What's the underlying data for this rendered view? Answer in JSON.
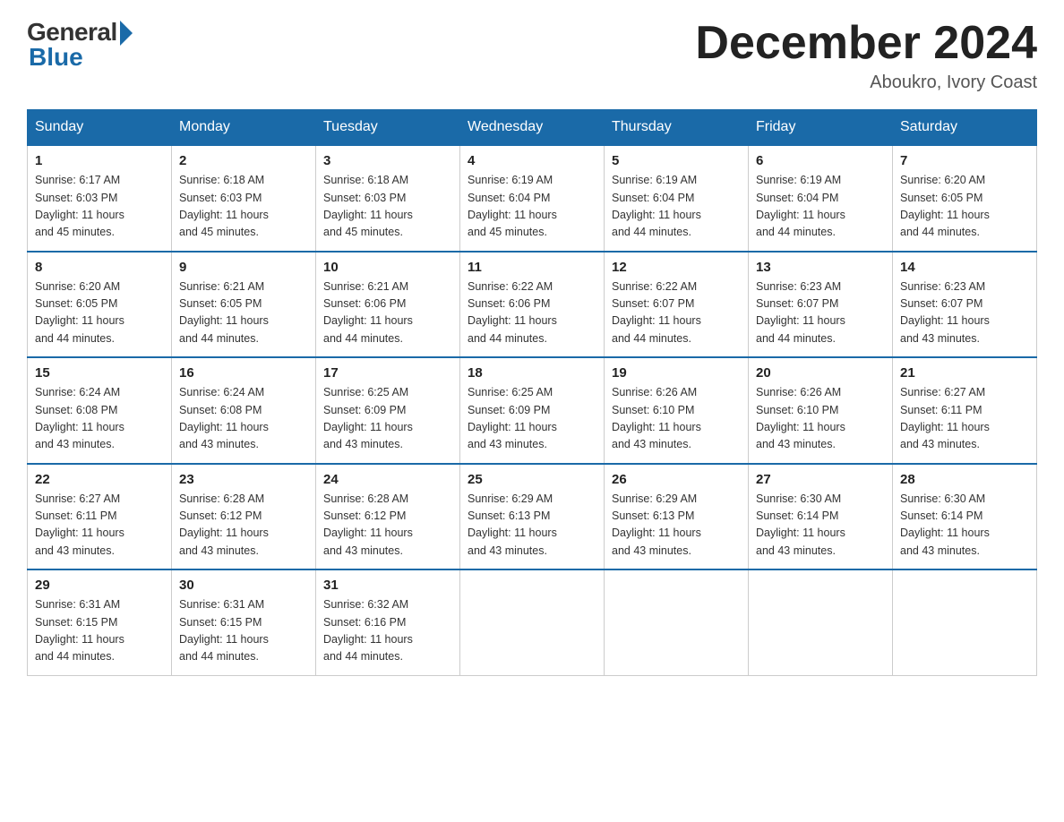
{
  "logo": {
    "general": "General",
    "blue": "Blue"
  },
  "title": "December 2024",
  "location": "Aboukro, Ivory Coast",
  "days_of_week": [
    "Sunday",
    "Monday",
    "Tuesday",
    "Wednesday",
    "Thursday",
    "Friday",
    "Saturday"
  ],
  "weeks": [
    [
      {
        "day": "1",
        "sunrise": "6:17 AM",
        "sunset": "6:03 PM",
        "daylight": "11 hours and 45 minutes."
      },
      {
        "day": "2",
        "sunrise": "6:18 AM",
        "sunset": "6:03 PM",
        "daylight": "11 hours and 45 minutes."
      },
      {
        "day": "3",
        "sunrise": "6:18 AM",
        "sunset": "6:03 PM",
        "daylight": "11 hours and 45 minutes."
      },
      {
        "day": "4",
        "sunrise": "6:19 AM",
        "sunset": "6:04 PM",
        "daylight": "11 hours and 45 minutes."
      },
      {
        "day": "5",
        "sunrise": "6:19 AM",
        "sunset": "6:04 PM",
        "daylight": "11 hours and 44 minutes."
      },
      {
        "day": "6",
        "sunrise": "6:19 AM",
        "sunset": "6:04 PM",
        "daylight": "11 hours and 44 minutes."
      },
      {
        "day": "7",
        "sunrise": "6:20 AM",
        "sunset": "6:05 PM",
        "daylight": "11 hours and 44 minutes."
      }
    ],
    [
      {
        "day": "8",
        "sunrise": "6:20 AM",
        "sunset": "6:05 PM",
        "daylight": "11 hours and 44 minutes."
      },
      {
        "day": "9",
        "sunrise": "6:21 AM",
        "sunset": "6:05 PM",
        "daylight": "11 hours and 44 minutes."
      },
      {
        "day": "10",
        "sunrise": "6:21 AM",
        "sunset": "6:06 PM",
        "daylight": "11 hours and 44 minutes."
      },
      {
        "day": "11",
        "sunrise": "6:22 AM",
        "sunset": "6:06 PM",
        "daylight": "11 hours and 44 minutes."
      },
      {
        "day": "12",
        "sunrise": "6:22 AM",
        "sunset": "6:07 PM",
        "daylight": "11 hours and 44 minutes."
      },
      {
        "day": "13",
        "sunrise": "6:23 AM",
        "sunset": "6:07 PM",
        "daylight": "11 hours and 44 minutes."
      },
      {
        "day": "14",
        "sunrise": "6:23 AM",
        "sunset": "6:07 PM",
        "daylight": "11 hours and 43 minutes."
      }
    ],
    [
      {
        "day": "15",
        "sunrise": "6:24 AM",
        "sunset": "6:08 PM",
        "daylight": "11 hours and 43 minutes."
      },
      {
        "day": "16",
        "sunrise": "6:24 AM",
        "sunset": "6:08 PM",
        "daylight": "11 hours and 43 minutes."
      },
      {
        "day": "17",
        "sunrise": "6:25 AM",
        "sunset": "6:09 PM",
        "daylight": "11 hours and 43 minutes."
      },
      {
        "day": "18",
        "sunrise": "6:25 AM",
        "sunset": "6:09 PM",
        "daylight": "11 hours and 43 minutes."
      },
      {
        "day": "19",
        "sunrise": "6:26 AM",
        "sunset": "6:10 PM",
        "daylight": "11 hours and 43 minutes."
      },
      {
        "day": "20",
        "sunrise": "6:26 AM",
        "sunset": "6:10 PM",
        "daylight": "11 hours and 43 minutes."
      },
      {
        "day": "21",
        "sunrise": "6:27 AM",
        "sunset": "6:11 PM",
        "daylight": "11 hours and 43 minutes."
      }
    ],
    [
      {
        "day": "22",
        "sunrise": "6:27 AM",
        "sunset": "6:11 PM",
        "daylight": "11 hours and 43 minutes."
      },
      {
        "day": "23",
        "sunrise": "6:28 AM",
        "sunset": "6:12 PM",
        "daylight": "11 hours and 43 minutes."
      },
      {
        "day": "24",
        "sunrise": "6:28 AM",
        "sunset": "6:12 PM",
        "daylight": "11 hours and 43 minutes."
      },
      {
        "day": "25",
        "sunrise": "6:29 AM",
        "sunset": "6:13 PM",
        "daylight": "11 hours and 43 minutes."
      },
      {
        "day": "26",
        "sunrise": "6:29 AM",
        "sunset": "6:13 PM",
        "daylight": "11 hours and 43 minutes."
      },
      {
        "day": "27",
        "sunrise": "6:30 AM",
        "sunset": "6:14 PM",
        "daylight": "11 hours and 43 minutes."
      },
      {
        "day": "28",
        "sunrise": "6:30 AM",
        "sunset": "6:14 PM",
        "daylight": "11 hours and 43 minutes."
      }
    ],
    [
      {
        "day": "29",
        "sunrise": "6:31 AM",
        "sunset": "6:15 PM",
        "daylight": "11 hours and 44 minutes."
      },
      {
        "day": "30",
        "sunrise": "6:31 AM",
        "sunset": "6:15 PM",
        "daylight": "11 hours and 44 minutes."
      },
      {
        "day": "31",
        "sunrise": "6:32 AM",
        "sunset": "6:16 PM",
        "daylight": "11 hours and 44 minutes."
      },
      null,
      null,
      null,
      null
    ]
  ],
  "labels": {
    "sunrise": "Sunrise:",
    "sunset": "Sunset:",
    "daylight": "Daylight:"
  }
}
